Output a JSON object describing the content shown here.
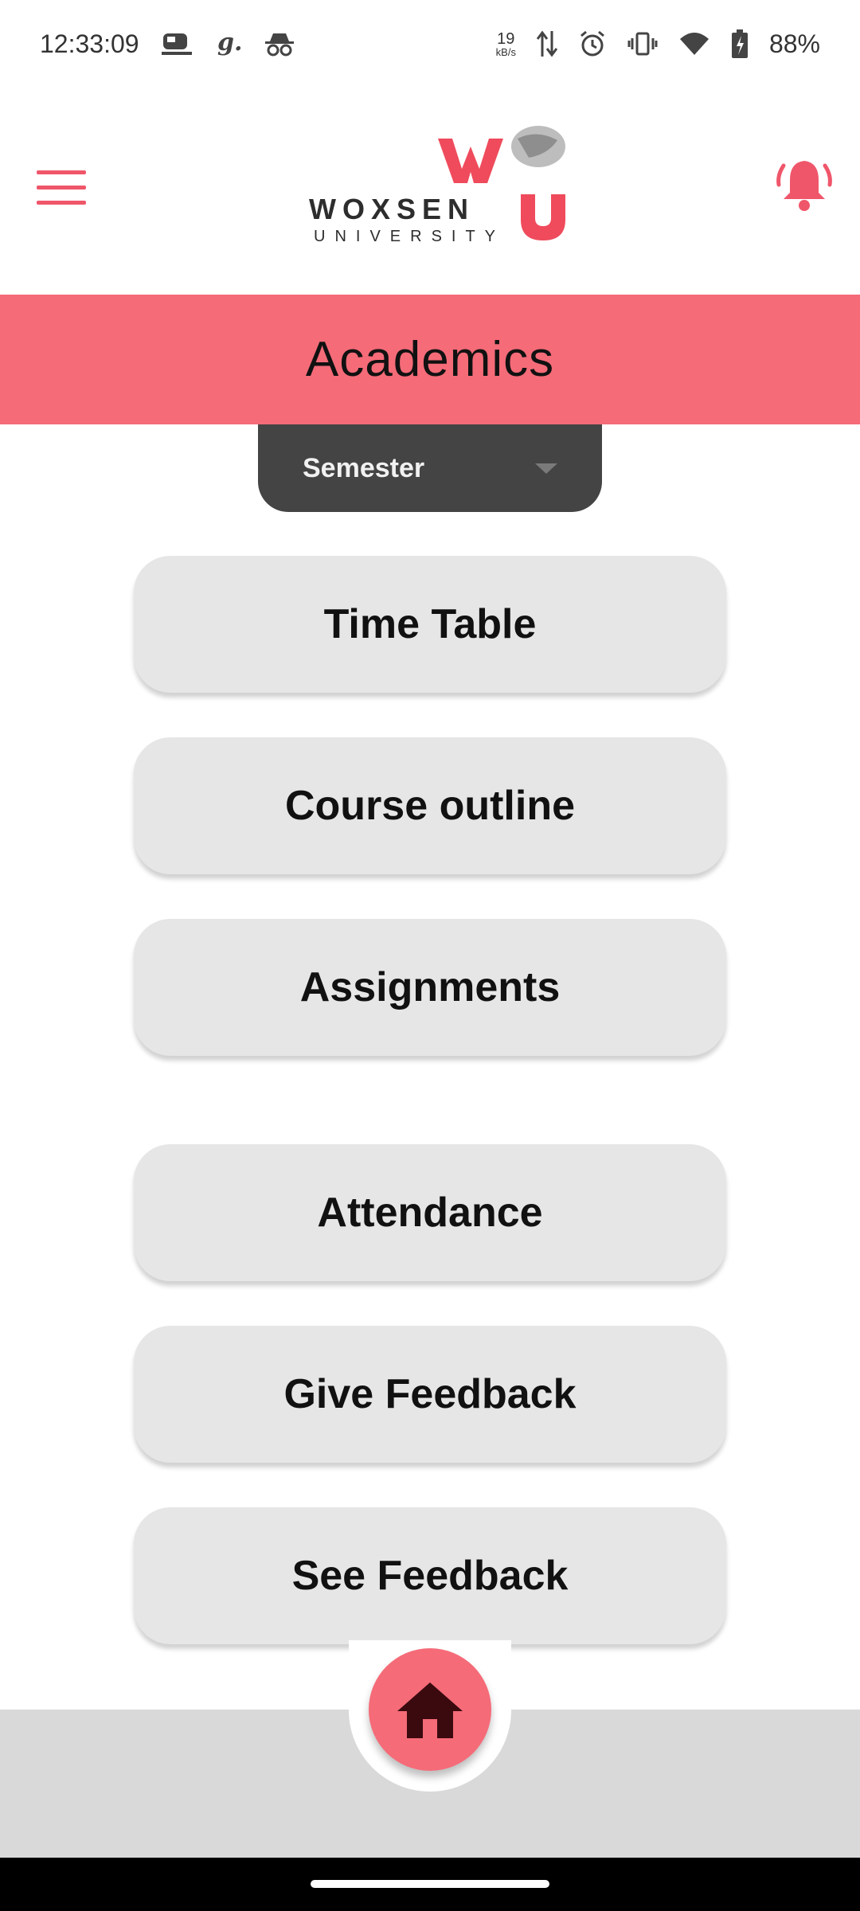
{
  "status_bar": {
    "time": "12:33:09",
    "net_speed_value": "19",
    "net_speed_unit": "kB/s",
    "battery": "88%",
    "icons": [
      "train-icon",
      "g-icon",
      "incognito-icon",
      "data-arrows-icon",
      "alarm-icon",
      "vibrate-icon",
      "wifi-icon",
      "battery-icon"
    ]
  },
  "header": {
    "logo_text": "WOXSEN",
    "logo_sub": "UNIVERSITY",
    "menu_icon": "hamburger-icon",
    "notification_icon": "bell-icon",
    "brand_color": "#f56b78"
  },
  "banner": {
    "title": "Academics"
  },
  "dropdown": {
    "selected": "Semester"
  },
  "menu": {
    "items": [
      {
        "label": "Time Table"
      },
      {
        "label": "Course outline"
      },
      {
        "label": "Assignments"
      },
      {
        "label": "Attendance"
      },
      {
        "label": "Give Feedback"
      },
      {
        "label": "See Feedback"
      }
    ]
  },
  "bottom_nav": {
    "home_icon": "home-icon"
  }
}
